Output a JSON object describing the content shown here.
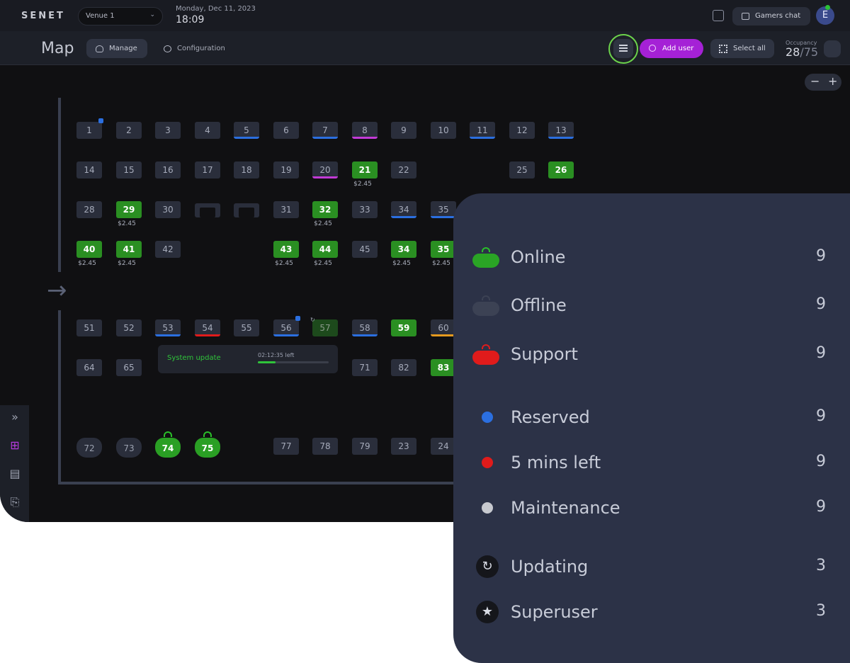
{
  "topbar": {
    "logo": "SENET",
    "venue": "Venue 1",
    "date": "Monday, Dec 11, 2023",
    "time": "18:09",
    "gamers_chat": "Gamers chat",
    "avatar_initial": "E"
  },
  "subbar": {
    "title": "Map",
    "manage": "Manage",
    "configuration": "Configuration",
    "add_user": "Add user",
    "select_all": "Select all",
    "occupancy_label": "Occupancy",
    "occupancy_current": "28",
    "occupancy_total": "/75"
  },
  "zoom": {
    "minus": "−",
    "plus": "+"
  },
  "stations": {
    "s1": "1",
    "s2": "2",
    "s3": "3",
    "s4": "4",
    "s5": "5",
    "s6": "6",
    "s7": "7",
    "s8": "8",
    "s9": "9",
    "s10": "10",
    "s11": "11",
    "s12": "12",
    "s13": "13",
    "s14": "14",
    "s15": "15",
    "s16": "16",
    "s17": "17",
    "s18": "18",
    "s19": "19",
    "s20": "20",
    "s21": "21",
    "s22": "22",
    "s25": "25",
    "s26": "26",
    "s28": "28",
    "s29": "29",
    "s30": "30",
    "s31": "31",
    "s32": "32",
    "s33": "33",
    "s34": "34",
    "s35": "35",
    "s40": "40",
    "s41": "41",
    "s42": "42",
    "s43": "43",
    "s44": "44",
    "s45": "45",
    "s34b": "34",
    "s35b": "35",
    "s51": "51",
    "s52": "52",
    "s53": "53",
    "s54": "54",
    "s55": "55",
    "s56": "56",
    "s57": "57",
    "s58": "58",
    "s59": "59",
    "s60": "60",
    "s64": "64",
    "s65": "65",
    "s71": "71",
    "s82": "82",
    "s83": "83",
    "s72": "72",
    "s73": "73",
    "s74": "74",
    "s75": "75",
    "s77": "77",
    "s78": "78",
    "s79": "79",
    "s23": "23",
    "s24": "24"
  },
  "price": "$2.45",
  "tooltip": {
    "label": "System update",
    "time_left": "02:12:35 left",
    "progress": 0.25
  },
  "legend": {
    "online": {
      "label": "Online",
      "count": "9"
    },
    "offline": {
      "label": "Offline",
      "count": "9"
    },
    "support": {
      "label": "Support",
      "count": "9"
    },
    "reserved": {
      "label": "Reserved",
      "count": "9"
    },
    "five_mins": {
      "label": "5 mins left",
      "count": "9"
    },
    "maintenance": {
      "label": "Maintenance",
      "count": "9"
    },
    "updating": {
      "label": "Updating",
      "count": "3"
    },
    "superuser": {
      "label": "Superuser",
      "count": "3"
    }
  },
  "colors": {
    "online": "#2a8f22",
    "reserved": "#2b6fe0",
    "five_mins": "#e01b1b",
    "maintenance": "#c7c9cf",
    "support": "#e01b1b",
    "offline": "#3c4254",
    "accent": "#a521d6",
    "magenta": "#c23ad6",
    "orange": "#e59a1f"
  },
  "icons": [
    "list-icon",
    "add-user-icon",
    "select-all-icon",
    "chat-icon",
    "gear-icon",
    "manage-icon",
    "arrow-right-icon",
    "gamepad-icon",
    "sync-icon",
    "star-icon",
    "expand-icon",
    "map-icon",
    "store-icon",
    "exit-icon"
  ]
}
